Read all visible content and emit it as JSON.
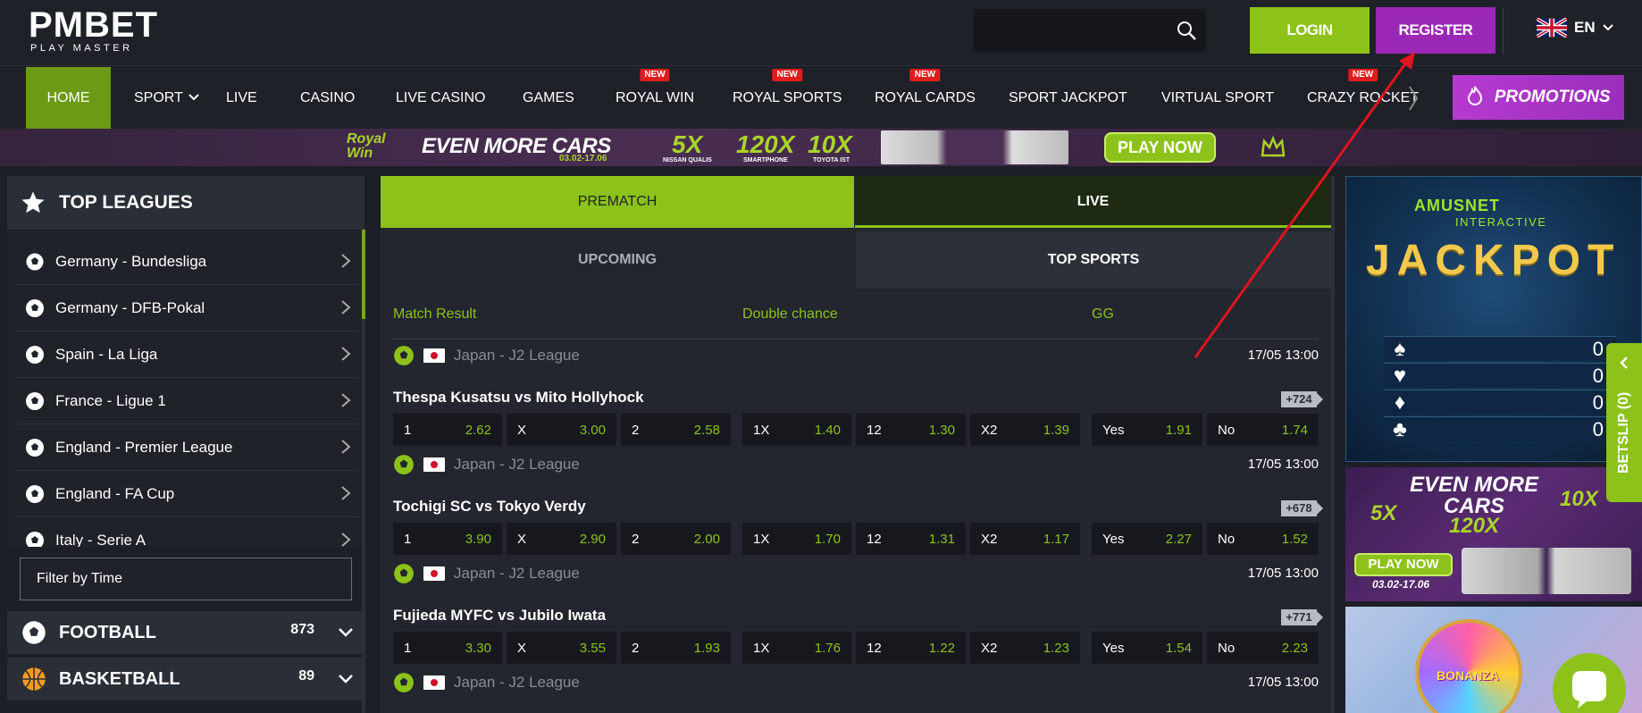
{
  "header": {
    "logo_main": "PMBET",
    "logo_sub": "PLAY MASTER",
    "search_value": "",
    "login_label": "LOGIN",
    "register_label": "REGISTER",
    "language": "EN"
  },
  "nav": {
    "items": [
      {
        "label": "HOME"
      },
      {
        "label": "SPORT"
      },
      {
        "label": "LIVE"
      },
      {
        "label": "CASINO"
      },
      {
        "label": "LIVE CASINO"
      },
      {
        "label": "GAMES"
      },
      {
        "label": "ROYAL WIN",
        "badge": "NEW"
      },
      {
        "label": "ROYAL SPORTS",
        "badge": "NEW"
      },
      {
        "label": "ROYAL CARDS",
        "badge": "NEW"
      },
      {
        "label": "SPORT JACKPOT"
      },
      {
        "label": "VIRTUAL SPORT"
      },
      {
        "label": "CRAZY ROCKET",
        "badge": "NEW"
      }
    ],
    "promotions_label": "PROMOTIONS"
  },
  "banner": {
    "brand_top": "Royal",
    "brand_bottom": "Win",
    "title": "EVEN MORE CARS",
    "date": "03.02-17.06",
    "m1": "5X",
    "m1_sub": "NISSAN QUALIS",
    "m2": "120X",
    "m2_sub": "SMARTPHONE",
    "m3": "10X",
    "m3_sub": "TOYOTA IST",
    "play_label": "PLAY NOW"
  },
  "sidebar": {
    "title": "TOP LEAGUES",
    "leagues": [
      "Germany - Bundesliga",
      "Germany - DFB-Pokal",
      "Spain - La Liga",
      "France - Ligue 1",
      "England - Premier League",
      "England - FA Cup",
      "Italy - Serie A"
    ],
    "filter_label": "Filter by Time",
    "sports": [
      {
        "name": "FOOTBALL",
        "count": "873"
      },
      {
        "name": "BASKETBALL",
        "count": "89"
      }
    ]
  },
  "main": {
    "tab_prematch": "PREMATCH",
    "tab_live": "LIVE",
    "tab_upcoming": "UPCOMING",
    "tab_topsports": "TOP SPORTS",
    "market_1": "Match Result",
    "market_2": "Double chance",
    "market_3": "GG",
    "matches": [
      {
        "league": "Japan - J2 League",
        "time": "17/05 13:00",
        "title": "Thespa Kusatsu vs Mito Hollyhock",
        "more": "+724",
        "odds": [
          [
            "1",
            "2.62"
          ],
          [
            "X",
            "3.00"
          ],
          [
            "2",
            "2.58"
          ],
          [
            "1X",
            "1.40"
          ],
          [
            "12",
            "1.30"
          ],
          [
            "X2",
            "1.39"
          ],
          [
            "Yes",
            "1.91"
          ],
          [
            "No",
            "1.74"
          ]
        ]
      },
      {
        "league": "Japan - J2 League",
        "time": "17/05 13:00",
        "title": "Tochigi SC vs Tokyo Verdy",
        "more": "+678",
        "odds": [
          [
            "1",
            "3.90"
          ],
          [
            "X",
            "2.90"
          ],
          [
            "2",
            "2.00"
          ],
          [
            "1X",
            "1.70"
          ],
          [
            "12",
            "1.31"
          ],
          [
            "X2",
            "1.17"
          ],
          [
            "Yes",
            "2.27"
          ],
          [
            "No",
            "1.52"
          ]
        ]
      },
      {
        "league": "Japan - J2 League",
        "time": "17/05 13:00",
        "title": "Fujieda MYFC vs Jubilo Iwata",
        "more": "+771",
        "odds": [
          [
            "1",
            "3.30"
          ],
          [
            "X",
            "3.55"
          ],
          [
            "2",
            "1.93"
          ],
          [
            "1X",
            "1.76"
          ],
          [
            "12",
            "1.22"
          ],
          [
            "X2",
            "1.23"
          ],
          [
            "Yes",
            "1.54"
          ],
          [
            "No",
            "2.23"
          ]
        ]
      }
    ],
    "last_league": "Japan - J2 League",
    "last_time": "17/05 13:00"
  },
  "right": {
    "amusnet": "AMUSNET",
    "amusnet_sub": "INTERACTIVE",
    "jackpot_title": "JACKPOT",
    "jackpot_values": [
      "0",
      "0",
      "0",
      "0"
    ],
    "promo_title_1": "EVEN MORE",
    "promo_title_2": "CARS",
    "promo_m1": "5X",
    "promo_m2": "120X",
    "promo_m3": "10X",
    "promo_play": "PLAY NOW",
    "promo_date": "03.02-17.06",
    "bonanza": "BONANZA",
    "betslip": "BETSLIP (0)"
  },
  "colors": {
    "accent_green": "#8cc21a",
    "register_purple": "#9b27b6",
    "new_badge_red": "#e01c1c",
    "annotation_arrow": "#e0141e"
  }
}
